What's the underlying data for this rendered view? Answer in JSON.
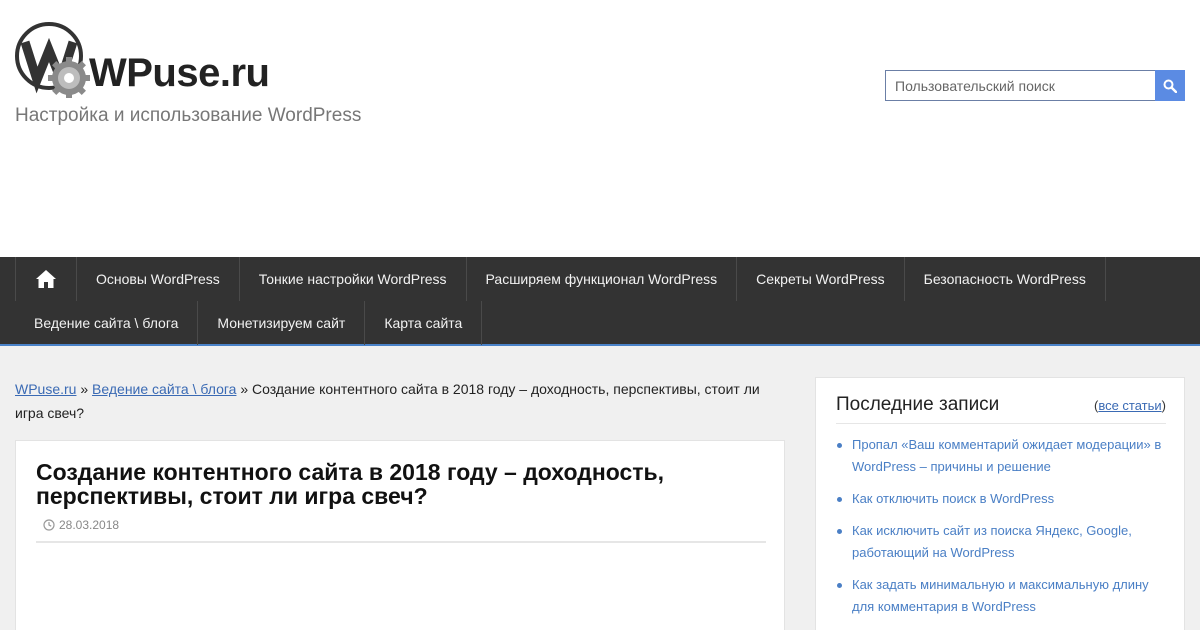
{
  "site": {
    "name": "WPuse.ru",
    "tagline": "Настройка и использование WordPress"
  },
  "search": {
    "placeholder": "Пользовательский поиск"
  },
  "nav": {
    "row1": [
      "Основы WordPress",
      "Тонкие настройки WordPress",
      "Расширяем функционал WordPress",
      "Секреты WordPress",
      "Безопасность WordPress"
    ],
    "row2": [
      "Ведение сайта \\ блога",
      "Монетизируем сайт",
      "Карта сайта"
    ]
  },
  "breadcrumb": {
    "home": "WPuse.ru",
    "sep": "»",
    "category": "Ведение сайта \\ блога",
    "current": "Создание контентного сайта в 2018 году – доходность, перспективы, стоит ли игра свеч?"
  },
  "article": {
    "title": "Создание контентного сайта в 2018 году – доходность, перспективы, стоит ли игра свеч?",
    "date": "28.03.2018"
  },
  "sidebar": {
    "title": "Последние записи",
    "all_open": "(",
    "all_link": "все статьи",
    "all_close": ")",
    "posts": [
      "Пропал «Ваш комментарий ожидает модерации» в WordPress – причины и решение",
      "Как отключить поиск в WordPress",
      "Как исключить сайт из поиска Яндекс, Google, работающий на WordPress",
      "Как задать минимальную и максимальную длину для комментария в WordPress"
    ]
  },
  "colors": {
    "nav_bg": "#333333",
    "accent": "#4a82c8",
    "link": "#3a6ab4",
    "search_button": "#5b8be3"
  }
}
